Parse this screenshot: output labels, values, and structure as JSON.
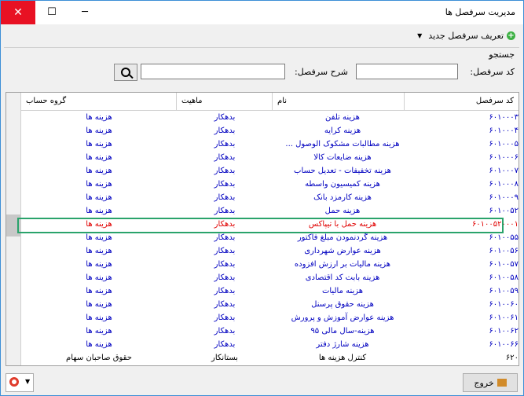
{
  "window": {
    "title": "مدیریت سرفصل ها",
    "minimize": "─",
    "maximize": "☐",
    "close": "✕"
  },
  "menu": {
    "new_label": "تعریف سرفصل جدید"
  },
  "search": {
    "legend": "جستجو",
    "code_label": "کد سرفصل:",
    "desc_label": "شرح سرفصل:",
    "code_value": "",
    "desc_value": ""
  },
  "grid": {
    "columns": [
      "کد سرفصل",
      "نام",
      "ماهیت",
      "گروه حساب"
    ],
    "rows": [
      {
        "code": "۶۰۱۰۰۰۳",
        "name": "هزینه تلفن",
        "nature": "بدهکار",
        "group": "هزینه ها"
      },
      {
        "code": "۶۰۱۰۰۰۴",
        "name": "هزینه کرایه",
        "nature": "بدهکار",
        "group": "هزینه ها"
      },
      {
        "code": "۶۰۱۰۰۰۵",
        "name": "هزینه مطالبات مشکوک الوصول ...",
        "nature": "بدهکار",
        "group": "هزینه ها"
      },
      {
        "code": "۶۰۱۰۰۰۶",
        "name": "هزینه ضایعات کالا",
        "nature": "بدهکار",
        "group": "هزینه ها"
      },
      {
        "code": "۶۰۱۰۰۰۷",
        "name": "هزینه تخفیفات - تعدیل حساب",
        "nature": "بدهکار",
        "group": "هزینه ها"
      },
      {
        "code": "۶۰۱۰۰۰۸",
        "name": "هزینه کمیسیون واسطه",
        "nature": "بدهکار",
        "group": "هزینه ها"
      },
      {
        "code": "۶۰۱۰۰۰۹",
        "name": "هزینه کارمزد بانک",
        "nature": "بدهکار",
        "group": "هزینه ها"
      },
      {
        "code": "۶۰۱۰۰۵۲",
        "name": "هزینه حمل",
        "nature": "بدهکار",
        "group": "هزینه ها"
      },
      {
        "code": "۶۰۱۰۰۵۲۰۰۰۱",
        "name": "هزینه حمل با تیپاکس",
        "nature": "بدهکار",
        "group": "هزینه ها",
        "selected": true
      },
      {
        "code": "۶۰۱۰۰۵۵",
        "name": "هزینه گردنمودن مبلغ فاکتور",
        "nature": "بدهکار",
        "group": "هزینه ها"
      },
      {
        "code": "۶۰۱۰۰۵۶",
        "name": "هزینه عوارض شهرداری",
        "nature": "بدهکار",
        "group": "هزینه ها"
      },
      {
        "code": "۶۰۱۰۰۵۷",
        "name": "هزینه مالیات بر ارزش افزوده",
        "nature": "بدهکار",
        "group": "هزینه ها"
      },
      {
        "code": "۶۰۱۰۰۵۸",
        "name": "هزینه بابت کد اقتصادی",
        "nature": "بدهکار",
        "group": "هزینه ها"
      },
      {
        "code": "۶۰۱۰۰۵۹",
        "name": "هزینه مالیات",
        "nature": "بدهکار",
        "group": "هزینه ها"
      },
      {
        "code": "۶۰۱۰۰۶۰",
        "name": "هزینه حقوق پرسنل",
        "nature": "بدهکار",
        "group": "هزینه ها"
      },
      {
        "code": "۶۰۱۰۰۶۱",
        "name": "هزینه عوارض آموزش و پرورش",
        "nature": "بدهکار",
        "group": "هزینه ها"
      },
      {
        "code": "۶۰۱۰۰۶۲",
        "name": "هزینه-سال مالی ۹۵",
        "nature": "بدهکار",
        "group": "هزینه ها"
      },
      {
        "code": "۶۰۱۰۰۶۶",
        "name": "هزینه شارژ دفتر",
        "nature": "بدهکار",
        "group": "هزینه ها"
      },
      {
        "code": "۶۲۰",
        "name": "کنترل هزینه ها",
        "nature": "بستانکار",
        "group": "حقوق صاحبان سهام",
        "black": true
      }
    ]
  },
  "footer": {
    "exit_label": "خروج"
  }
}
